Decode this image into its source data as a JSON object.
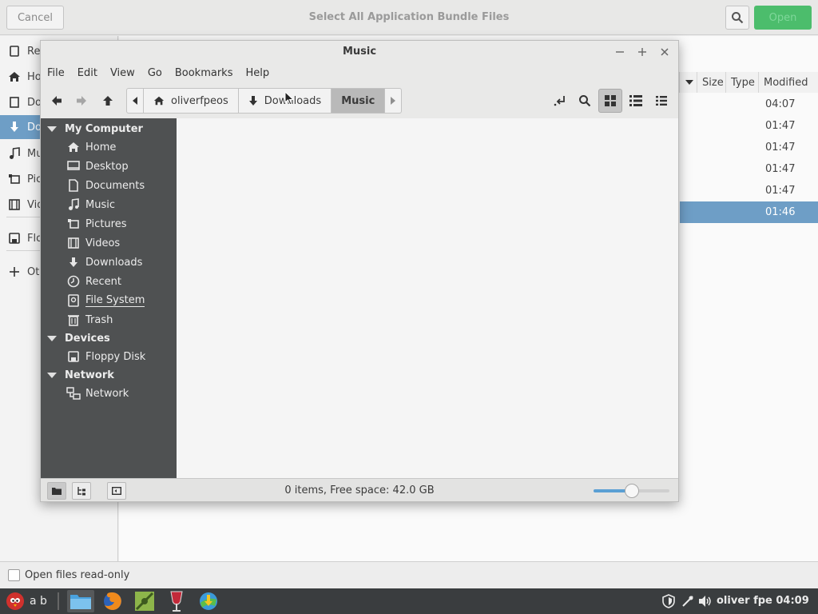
{
  "background_dialog": {
    "cancel_label": "Cancel",
    "title": "Select All Application Bundle Files",
    "open_label": "Open",
    "sidebar_items": [
      "Re",
      "Ho",
      "Do",
      "Do",
      "Mu",
      "Pic",
      "Vid",
      "Flo",
      "Ot"
    ],
    "columns": {
      "size": "Size",
      "type": "Type",
      "modified": "Modified"
    },
    "rows": [
      "04:07",
      "01:47",
      "01:47",
      "01:47",
      "01:47",
      "01:46"
    ],
    "read_only_label": "Open files read-only"
  },
  "window": {
    "title": "Music",
    "menu": [
      "File",
      "Edit",
      "View",
      "Go",
      "Bookmarks",
      "Help"
    ],
    "breadcrumbs": {
      "home": "oliverfpeos",
      "downloads": "Downloads",
      "music": "Music"
    },
    "sidebar": {
      "sections": {
        "computer": "My Computer",
        "devices": "Devices",
        "network": "Network"
      },
      "computer_items": [
        "Home",
        "Desktop",
        "Documents",
        "Music",
        "Pictures",
        "Videos",
        "Downloads",
        "Recent",
        "File System",
        "Trash"
      ],
      "device_items": [
        "Floppy Disk"
      ],
      "network_items": [
        "Network"
      ]
    },
    "status_text": "0 items, Free space: 42.0 GB",
    "zoom_level": 0.5
  },
  "taskbar": {
    "text_ab": "a b",
    "tray_text": "oliver fpe 04:09"
  },
  "colors": {
    "selection": "#6e9ec6",
    "sidebar_bg": "#4f5152",
    "open_button": "#4cbd6c",
    "slider": "#5a9fd4"
  }
}
